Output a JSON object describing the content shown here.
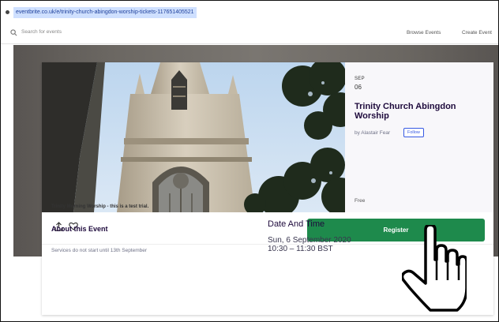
{
  "browser": {
    "url": "eventbrite.co.uk/e/trinity-church-abingdon-worship-tickets-117651405521"
  },
  "header": {
    "search_placeholder": "Search for events",
    "nav_browse": "Browse Events",
    "nav_create": "Create Event"
  },
  "event": {
    "date_month": "SEP",
    "date_day": "06",
    "title": "Trinity Church Abingdon Worship",
    "organizer": "by Alastair Fear",
    "follow_label": "Follow",
    "price": "Free"
  },
  "actions": {
    "register_label": "Register"
  },
  "body": {
    "blurb": "Trinity Morning Worship - this is a test trial.",
    "about_heading": "About this Event",
    "about_text": "Services do not start until 13th September",
    "date_time_heading": "Date And Time",
    "date_line": "Sun, 6 September 2020",
    "time_line": "10:30 – 11:30 BST"
  },
  "colors": {
    "register_green": "#1e8a4c",
    "title": "#1e0a3c",
    "link_blue": "#3659e3"
  },
  "icons": [
    "lock-icon",
    "search-icon",
    "share-icon",
    "heart-icon",
    "hand-pointer-icon"
  ]
}
